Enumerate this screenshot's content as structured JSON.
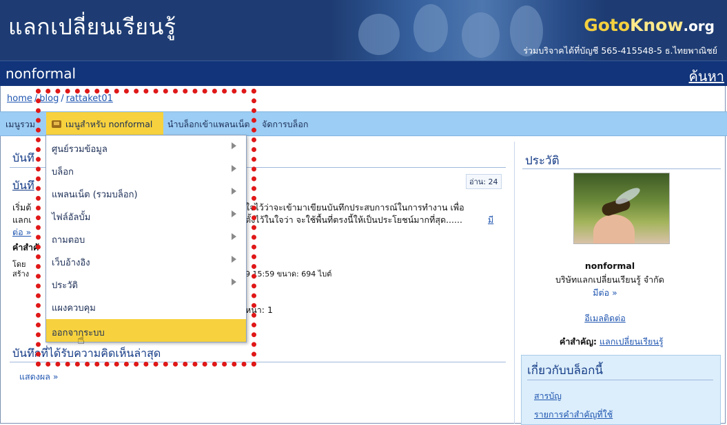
{
  "header": {
    "site_title": "แลกเปลี่ยนเรียนรู้",
    "logo_goto": "Goto",
    "logo_know": "Know",
    "logo_org": ".org",
    "donate_text": "ร่วมบริจาคได้ที่บัญชี 565-415548-5 ธ.ไทยพาณิชย์"
  },
  "subbar": {
    "blog_name": "nonformal",
    "search_label": "ค้นหา"
  },
  "breadcrumb": {
    "items": [
      "home",
      "blog",
      "rattaket01"
    ],
    "separator": "/"
  },
  "menubar": {
    "items": [
      "เมนูรวม",
      "เมนูสำหรับ nonformal",
      "นำบล็อกเข้าแพลนเน็ต",
      "จัดการบล็อก"
    ]
  },
  "main": {
    "section_title_partial": "บันทึ",
    "entry_title_partial": "บันทึ",
    "read_count": "อ่าน: 24",
    "body_line1_start": "เริ่มต้",
    "body_line1_end": "ใจไว้ว่าจะเข้ามาเขียนบันทึกประสบการณ์ในการทำงาน เพื่อ",
    "body_line2_start": "แลกเ",
    "body_line2_end": "ตั้งไว้ในใจว่า จะใช้พื้นที่ตรงนี้ให้เป็นประโยชน์มากที่สุด......",
    "read_more_inline": "มี",
    "read_more_line3": "ต่อ »",
    "keyword_label_partial": "คำสำคั",
    "by_text": "โดย",
    "created_text": "สร้าง",
    "timestamp_size": "9 15:59  ขนาด: 694 ไบต์",
    "page_text": "หน้า: 1",
    "latest_comments_title": "บันทึกที่ได้รับความคิดเห็นล่าสุด",
    "show_link": "แสดงผล »"
  },
  "dropdown": {
    "items": [
      {
        "label": "ศูนย์รวมข้อมูล",
        "has_submenu": true
      },
      {
        "label": "บล็อก",
        "has_submenu": true
      },
      {
        "label": "แพลนเน็ต (รวมบล็อก)",
        "has_submenu": true
      },
      {
        "label": "ไฟล์อัลบั้ม",
        "has_submenu": true
      },
      {
        "label": "ถามตอบ",
        "has_submenu": true
      },
      {
        "label": "เว็บอ้างอิง",
        "has_submenu": true
      },
      {
        "label": "ประวัติ",
        "has_submenu": true
      },
      {
        "label": "แผงควบคุม",
        "has_submenu": false
      },
      {
        "label": "ออกจากระบบ",
        "has_submenu": false
      }
    ],
    "active_index": 8
  },
  "sidebar": {
    "profile_title": "ประวัติ",
    "profile_name": "nonformal",
    "profile_org": "บริษัทแลกเปลี่ยนเรียนรู้ จำกัด",
    "profile_more": "มีต่อ »",
    "email_link": "อีเมลติดต่อ",
    "keyword_label": "คำสำคัญ:",
    "keyword_value": "แลกเปลี่ยนเรียนรู้",
    "about_title": "เกี่ยวกับบล็อกนี้",
    "about_links": [
      "สารบัญ",
      "รายการคำสำคัญที่ใช้"
    ]
  },
  "colors": {
    "header_bg": "#1e3c73",
    "subbar_bg": "#11347a",
    "menubar_bg": "#9ccdf4",
    "active_menu": "#f7d23e",
    "highlight_border": "#e01818",
    "link": "#1f55b0"
  },
  "icons": {
    "menu_flag": "folder-flag-icon",
    "submenu_arrow": "chevron-right-icon",
    "cursor": "hand-pointer-icon"
  }
}
